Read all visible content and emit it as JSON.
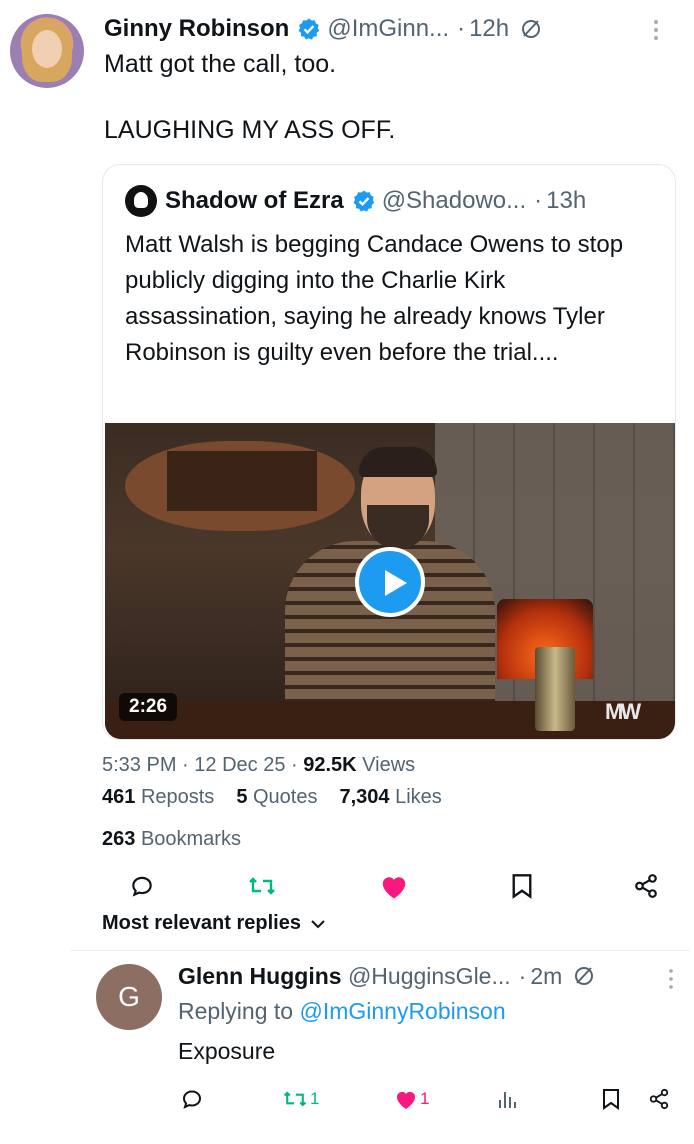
{
  "tweet": {
    "display_name": "Ginny Robinson",
    "handle": "@ImGinn...",
    "separator": "·",
    "time": "12h",
    "text": "Matt got the call, too.\n\nLAUGHING MY ASS OFF.",
    "verified_color": "#1d9bf0"
  },
  "quote": {
    "display_name": "Shadow of Ezra",
    "handle": "@Shadowo...",
    "separator": "·",
    "time": "13h",
    "text": "Matt Walsh is begging Candace Owens to stop publicly digging into the Charlie Kirk assassination, saying he already knows Tyler Robinson is guilty even before the trial....",
    "video": {
      "duration": "2:26",
      "brand_mark": "MW"
    }
  },
  "meta": {
    "time": "5:33 PM",
    "date": "12 Dec 25",
    "views_count": "92.5K",
    "views_label": "Views"
  },
  "stats": {
    "reposts_count": "461",
    "reposts_label": "Reposts",
    "quotes_count": "5",
    "quotes_label": "Quotes",
    "likes_count": "7,304",
    "likes_label": "Likes",
    "bookmarks_count": "263",
    "bookmarks_label": "Bookmarks"
  },
  "actions": {
    "icons": [
      "reply-icon",
      "repost-icon",
      "like-icon",
      "bookmark-icon",
      "share-icon"
    ],
    "repost_color": "#00ba7c",
    "like_color": "#f91880"
  },
  "replies_sort": {
    "label": "Most relevant replies"
  },
  "reply": {
    "avatar_letter": "G",
    "avatar_color": "#8d6e63",
    "display_name": "Glenn Huggins",
    "handle": "@HugginsGle...",
    "separator": "·",
    "time": "2m",
    "replying_prefix": "Replying to",
    "replying_to": "@ImGinnyRobinson",
    "text": "Exposure",
    "repost_count": "1",
    "like_count": "1"
  }
}
